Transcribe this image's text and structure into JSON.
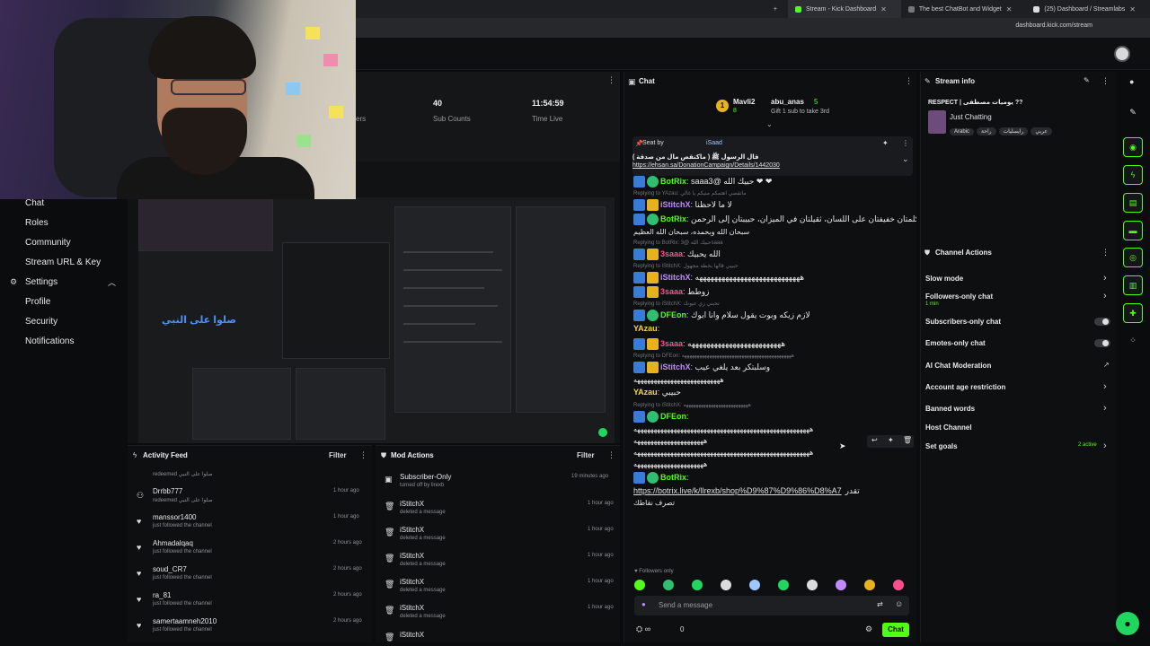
{
  "browser": {
    "tabs": [
      {
        "label": "Stream - Kick Dashboard",
        "active": true
      },
      {
        "label": "The best ChatBot and Widget",
        "active": false
      },
      {
        "label": "(25) Dashboard / Streamlabs",
        "active": false
      }
    ],
    "url": "dashboard.kick.com/stream"
  },
  "sidebar": {
    "items": [
      {
        "label": "Chat"
      },
      {
        "label": "Roles"
      },
      {
        "label": "Community"
      },
      {
        "label": "Stream URL & Key"
      },
      {
        "label": "Settings",
        "icon": "gear-icon"
      },
      {
        "label": "Profile"
      },
      {
        "label": "Security"
      },
      {
        "label": "Notifications"
      }
    ]
  },
  "stats": {
    "partial_label": "ers",
    "sub_counts": {
      "value": "40",
      "label": "Sub Counts"
    },
    "time_live": {
      "value": "11:54:59",
      "label": "Time Live"
    }
  },
  "preview": {
    "arabic_overlay": "صلوا على النبي"
  },
  "chat": {
    "title": "Chat",
    "top_gifters": [
      {
        "rank": "1",
        "name": "Mavli2",
        "count": "8"
      },
      {
        "name": "abu_anas",
        "count": "5"
      }
    ],
    "gift_cta": "Gift 1 sub to take 3rd",
    "pinned": {
      "by_label": "Seat by",
      "by_user": "iSaad",
      "text": "قال الرسول ﷺ ( ماكنقص مال من صدقة )",
      "link": "https://ehsan.sa/DonationCampaign/Details/1442030"
    },
    "messages": [
      {
        "type": "line",
        "name": "BotRix",
        "text": "saaaحبيك الله @3 ❤ ❤",
        "color": "green"
      },
      {
        "type": "reply",
        "text": "Replying to YAzau: ماتقضي اهتمكم منيكم يا غالي"
      },
      {
        "type": "line",
        "name": "iStitchX",
        "text": "لا ما لاحظنا",
        "color": "purple"
      },
      {
        "type": "line",
        "name": "BotRix",
        "text": "كلمتان خفيفتان على اللسان، ثقيلتان في الميزان، حبيبتان إلى الرحمن",
        "color": "green"
      },
      {
        "type": "cont",
        "text": "سبحان الله وبحمده، سبحان الله العظيم"
      },
      {
        "type": "reply",
        "text": "Replying to BotRix: حبيك الله @3saaa"
      },
      {
        "type": "line",
        "name": "3saaa",
        "text": "الله يحبيك",
        "color": "pink"
      },
      {
        "type": "reply",
        "text": "Replying to iStitchX: حبيبي قالها بخطه مجهول"
      },
      {
        "type": "line",
        "name": "iStitchX",
        "text": "ههههههههههههههههههههههههههههه",
        "color": "purple"
      },
      {
        "type": "line",
        "name": "3saaa",
        "text": "زوطط",
        "color": "pink"
      },
      {
        "type": "reply",
        "text": "Replying to iStitchX: تحبني زي عيونك"
      },
      {
        "type": "line",
        "name": "DFEon",
        "text": "لازم زيكه وبوت يقول سلام وانا ابوك",
        "color": "green"
      },
      {
        "type": "line",
        "name": "YAzau",
        "text": "",
        "color": "yellow"
      },
      {
        "type": "line",
        "name": "3saaa",
        "text": "هههههههههههههههههههههههههه",
        "color": "pink"
      },
      {
        "type": "reply",
        "text": "Replying to DFEon: ههههههههههههههههههههههههههههههههههههههههههههه"
      },
      {
        "type": "line",
        "name": "iStitchX",
        "text": "وسلبتكر بعد يلغي عيب",
        "color": "purple"
      },
      {
        "type": "cont",
        "text": "ههههههههههههههههههههههههههه"
      },
      {
        "type": "line",
        "name": "YAzau",
        "text": "حبيبي",
        "color": "yellow"
      },
      {
        "type": "reply",
        "text": "Replying to iStitchX: ههههههههههههههههههههههههههه"
      },
      {
        "type": "line",
        "name": "DFEon",
        "text": "",
        "color": "green"
      },
      {
        "type": "cont",
        "text": "هههههههههههههههههههههههههههههههههههههههههههههههههههههه"
      },
      {
        "type": "cont",
        "text": "هههههههههههههههههههههه"
      },
      {
        "type": "cont",
        "text": "هههههههههههههههههههههههههههههههههههههههههههههههههههههه"
      },
      {
        "type": "cont",
        "text": "هههههههههههههههههههههه"
      },
      {
        "type": "line",
        "name": "BotRix",
        "text": "",
        "color": "green"
      },
      {
        "type": "link",
        "text": "https://botrix.live/k/llrexb/shop%D9%87%D9%86%D8%A7",
        "suffix": "تقدر"
      },
      {
        "type": "cont",
        "text": "تصرف نقاطك"
      }
    ],
    "followers_only": "Followers only",
    "input_placeholder": "Send a message",
    "count": "0",
    "send_label": "Chat"
  },
  "stream_info": {
    "title": "Stream info",
    "stream_title": "RESPECT | يوميات مصطفى ??",
    "category": "Just Chatting",
    "tags": [
      "Arabic",
      "راحة",
      "رايسليات",
      "عربي"
    ]
  },
  "channel_actions": {
    "title": "Channel Actions",
    "items": [
      {
        "label": "Slow mode",
        "control": "chevron"
      },
      {
        "label": "Followers-only chat",
        "sub": "1 min",
        "control": "chevron"
      },
      {
        "label": "Subscribers-only chat",
        "control": "toggle"
      },
      {
        "label": "Emotes-only chat",
        "control": "toggle"
      },
      {
        "label": "AI Chat Moderation",
        "control": "external"
      },
      {
        "label": "Account age restriction",
        "control": "chevron"
      },
      {
        "label": "Banned words",
        "control": "chevron"
      },
      {
        "label": "Host Channel",
        "control": "none"
      },
      {
        "label": "Set goals",
        "sub": "2 active",
        "control": "chevron"
      }
    ]
  },
  "activity_feed": {
    "title": "Activity Feed",
    "filter": "Filter",
    "rows": [
      {
        "name": "",
        "sub": "redeemed صلوا على النبي",
        "time": ""
      },
      {
        "name": "Drrbb777",
        "sub": "redeemed صلوا على النبي",
        "time": "1 hour ago",
        "icon": "redeem-icon"
      },
      {
        "name": "manssor1400",
        "sub": "just followed the channel",
        "time": "1 hour ago",
        "icon": "heart-icon"
      },
      {
        "name": "Ahmadalqaq",
        "sub": "just followed the channel",
        "time": "2 hours ago",
        "icon": "heart-icon"
      },
      {
        "name": "soud_CR7",
        "sub": "just followed the channel",
        "time": "2 hours ago",
        "icon": "heart-icon"
      },
      {
        "name": "ra_81",
        "sub": "just followed the channel",
        "time": "2 hours ago",
        "icon": "heart-icon"
      },
      {
        "name": "samertaamneh2010",
        "sub": "just followed the channel",
        "time": "2 hours ago",
        "icon": "heart-icon"
      }
    ]
  },
  "mod_actions": {
    "title": "Mod Actions",
    "filter": "Filter",
    "rows": [
      {
        "name": "Subscriber-Only",
        "sub": "turned off by llrexb",
        "time": "19 minutes ago",
        "icon": "subscriber-icon"
      },
      {
        "name": "iStitchX",
        "sub": "deleted a message",
        "time": "1 hour ago",
        "icon": "trash-icon"
      },
      {
        "name": "iStitchX",
        "sub": "deleted a message",
        "time": "1 hour ago",
        "icon": "trash-icon"
      },
      {
        "name": "iStitchX",
        "sub": "deleted a message",
        "time": "1 hour ago",
        "icon": "trash-icon"
      },
      {
        "name": "iStitchX",
        "sub": "deleted a message",
        "time": "1 hour ago",
        "icon": "trash-icon"
      },
      {
        "name": "iStitchX",
        "sub": "deleted a message",
        "time": "1 hour ago",
        "icon": "trash-icon"
      },
      {
        "name": "iStitchX",
        "sub": "",
        "time": "",
        "icon": "trash-icon"
      }
    ]
  },
  "colors": {
    "accent": "#53fc18",
    "panel_bg": "#0e0f10",
    "page_bg": "#0b0c0d"
  }
}
